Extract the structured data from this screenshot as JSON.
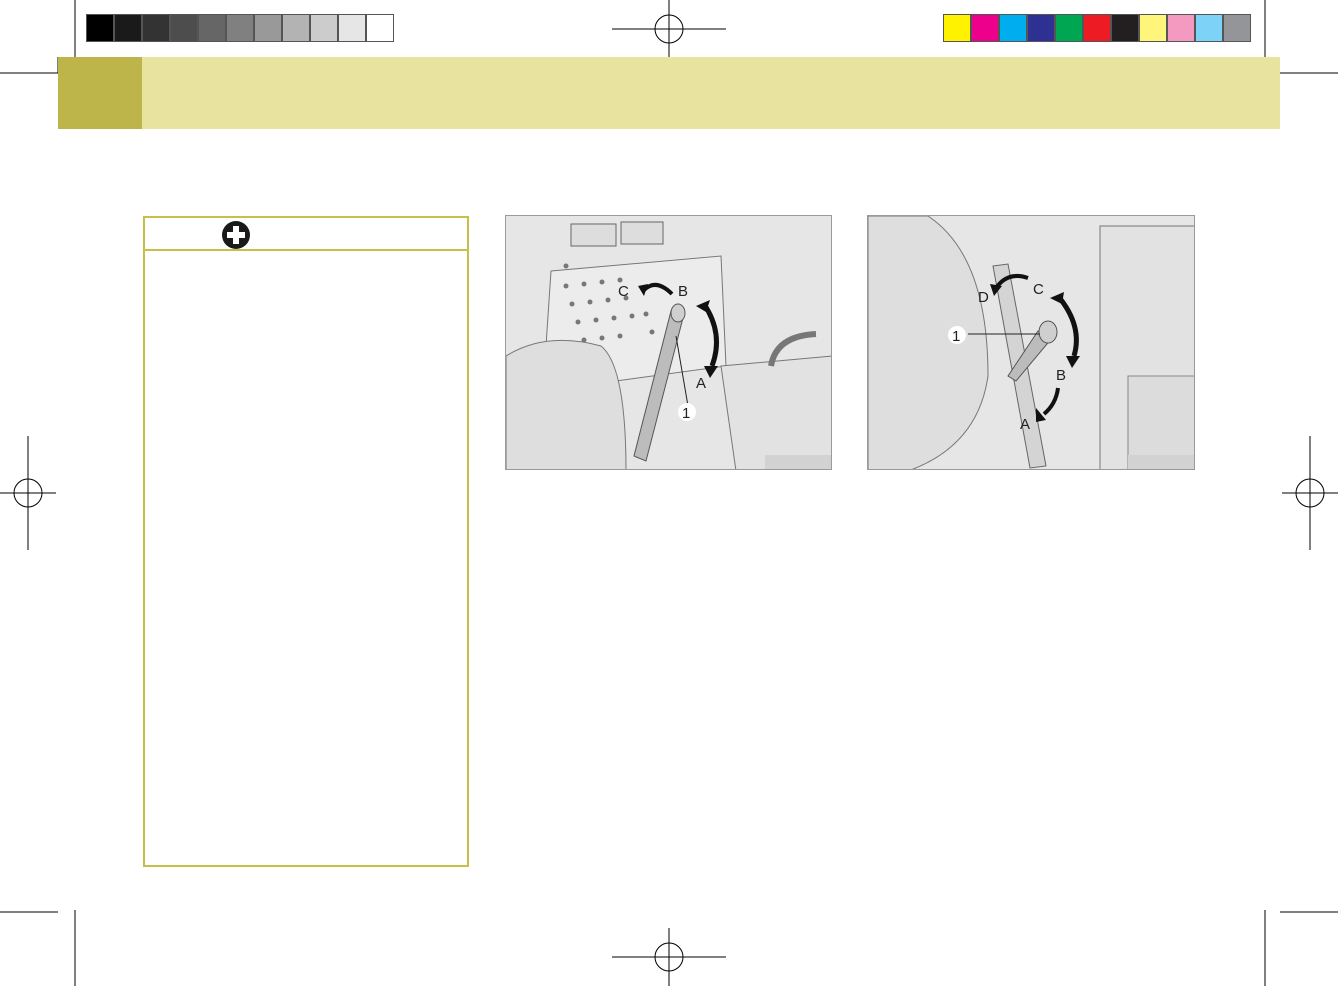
{
  "color_bar": {
    "grayscale": [
      "#000000",
      "#1a1a1a",
      "#333333",
      "#4d4d4d",
      "#666666",
      "#808080",
      "#999999",
      "#b3b3b3",
      "#cccccc",
      "#e6e6e6",
      "#ffffff"
    ],
    "process": [
      "#fff200",
      "#ec008c",
      "#00aeef",
      "#2e3192",
      "#00a651",
      "#ed1c24",
      "#231f20",
      "#fff57a",
      "#f49ac1",
      "#7dd3f7",
      "#939598"
    ]
  },
  "header": {
    "band_color": "#e8e4a0",
    "tab_color": "#bdb54a"
  },
  "warning_box": {
    "icon": "first-aid-cross-icon",
    "border_color": "#c8bf4a"
  },
  "figure1": {
    "labels": {
      "a": "A",
      "b": "B",
      "c": "C",
      "part": "1"
    }
  },
  "figure2": {
    "labels": {
      "a": "A",
      "b": "B",
      "c": "C",
      "d": "D",
      "part": "1"
    }
  }
}
